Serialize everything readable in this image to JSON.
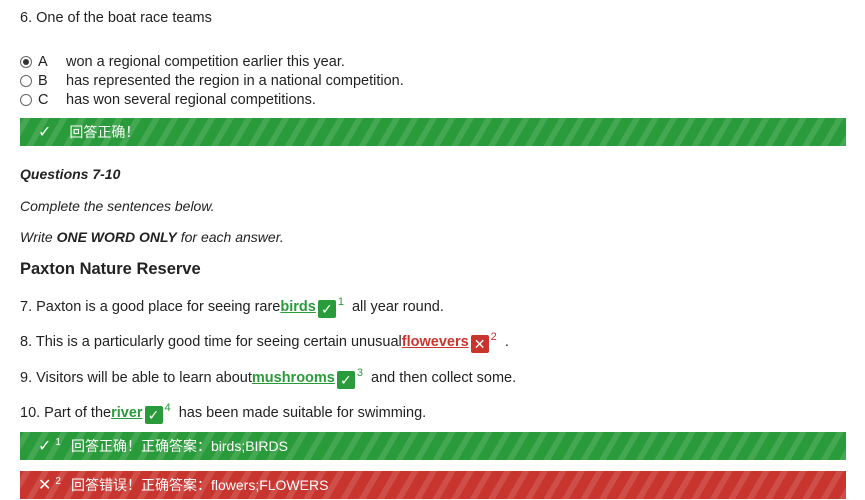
{
  "question6": {
    "text": "6. One of the boat race teams",
    "options": [
      {
        "letter": "A",
        "text": "won a regional competition earlier this year.",
        "selected": true
      },
      {
        "letter": "B",
        "text": "has represented the region in a national competition.",
        "selected": false
      },
      {
        "letter": "C",
        "text": "has won several regional competitions.",
        "selected": false
      }
    ],
    "feedback": "回答正确！"
  },
  "section": {
    "heading": "Questions 7-10",
    "instruction1": "Complete the sentences below.",
    "instruction2_pre": "Write ",
    "instruction2_bold": "ONE WORD ONLY",
    "instruction2_post": " for each answer.",
    "title": "Paxton Nature Reserve"
  },
  "sentences": [
    {
      "pre": "7. Paxton is a good place for seeing rare",
      "answer": "birds",
      "num": "1",
      "post": "  all year round.",
      "correct": true
    },
    {
      "pre": "8. This is a particularly good time for seeing certain unusual",
      "answer": "flowevers",
      "num": "2",
      "post": "  .",
      "correct": false
    },
    {
      "pre": "9. Visitors will be able to learn about",
      "answer": "mushrooms",
      "num": "3",
      "post": "  and then collect some.",
      "correct": true
    },
    {
      "pre": "10. Part of the",
      "answer": "river",
      "num": "4",
      "post": "  has been made suitable for swimming.",
      "correct": true
    }
  ],
  "results": [
    {
      "num": "1",
      "status": "回答正确！",
      "answer_label": "正确答案：",
      "answer": "birds;BIRDS",
      "correct": true
    },
    {
      "num": "2",
      "status": "回答错误！",
      "answer_label": "正确答案：",
      "answer": "flowers;FLOWERS",
      "correct": false
    }
  ],
  "icons": {
    "check": "✓",
    "cross": "✕"
  },
  "colors": {
    "correct": "#2a9b3a",
    "wrong": "#c8352f"
  }
}
